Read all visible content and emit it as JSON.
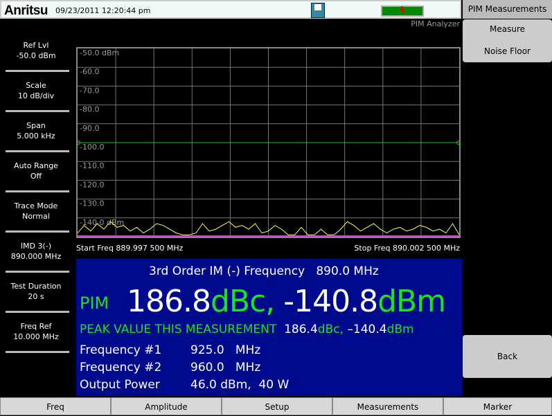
{
  "header": {
    "logo": "Anritsu",
    "datetime": "09/23/2011 12:20:44 pm",
    "mode": "PIM Analyzer",
    "battery_icon": "battery-charging-icon",
    "save_icon": "floppy-disk-icon"
  },
  "sidebar": [
    {
      "label": "Ref Lvl",
      "value": "-50.0 dBm"
    },
    {
      "label": "Scale",
      "value": "10 dB/div"
    },
    {
      "label": "Span",
      "value": "5.000 kHz"
    },
    {
      "label": "Auto Range",
      "value": "Off"
    },
    {
      "label": "Trace Mode",
      "value": "Normal"
    },
    {
      "label": "IMD 3(-)",
      "value": "890.000 MHz"
    },
    {
      "label": "Test Duration",
      "value": "20 s"
    },
    {
      "label": "Freq Ref",
      "value": "10.000 MHz"
    }
  ],
  "chart_data": {
    "type": "line",
    "ylim": [
      -150,
      -50
    ],
    "y_ticks": [
      "-50.0 dBm",
      "-60.0",
      "-70.0",
      "-80.0",
      "-90.0",
      "-100.0",
      "-110.0",
      "-120.0",
      "-130.0",
      "-140.0 dBm"
    ],
    "threshold": -100,
    "x_start": "Start Freq 889.997 500 MHz",
    "x_stop": "Stop Freq 890.002 500 MHz",
    "trace": [
      -148,
      -144,
      -147,
      -143,
      -146,
      -142,
      -145,
      -144,
      -147,
      -145,
      -148,
      -146,
      -143,
      -144,
      -146,
      -148,
      -149,
      -149,
      -148,
      -143,
      -147,
      -146,
      -144,
      -142,
      -145,
      -144,
      -146,
      -143,
      -148,
      -147,
      -144,
      -146,
      -149,
      -149,
      -145,
      -149,
      -149,
      -146,
      -149,
      -149,
      -146,
      -142,
      -144,
      -147,
      -145,
      -143,
      -146,
      -148,
      -146,
      -145,
      -147,
      -146,
      -144,
      -145,
      -147,
      -146,
      -148,
      -143,
      -149
    ],
    "colors": {
      "trace": "#ffff40",
      "threshold": "#20c020",
      "floor": "#d040d0"
    }
  },
  "panel": {
    "title": "3rd Order IM (-) Frequency   890.0 MHz",
    "pim_label": "PIM",
    "pim_dbc": "186.8",
    "dbc_unit": "dBc,",
    "pim_dbm": "-140.8",
    "dbm_unit": "dBm",
    "peak_label": "PEAK VALUE THIS MEASUREMENT",
    "peak_dbc": "186.4",
    "peak_dbc_unit": "dBc,",
    "peak_dbm": "–140.4",
    "peak_dbm_unit": "dBm",
    "rows": [
      {
        "label": "Frequency #1",
        "value": "925.0   MHz"
      },
      {
        "label": "Frequency #2",
        "value": "960.0   MHz"
      },
      {
        "label": "Output Power",
        "value": "46.0 dBm,  40 W"
      }
    ]
  },
  "right": {
    "title": "PIM Measurements",
    "measure": "Measure",
    "noise_floor": "Noise Floor",
    "back": "Back"
  },
  "tabs": [
    "Freq",
    "Amplitude",
    "Setup",
    "Measurements",
    "Marker"
  ]
}
